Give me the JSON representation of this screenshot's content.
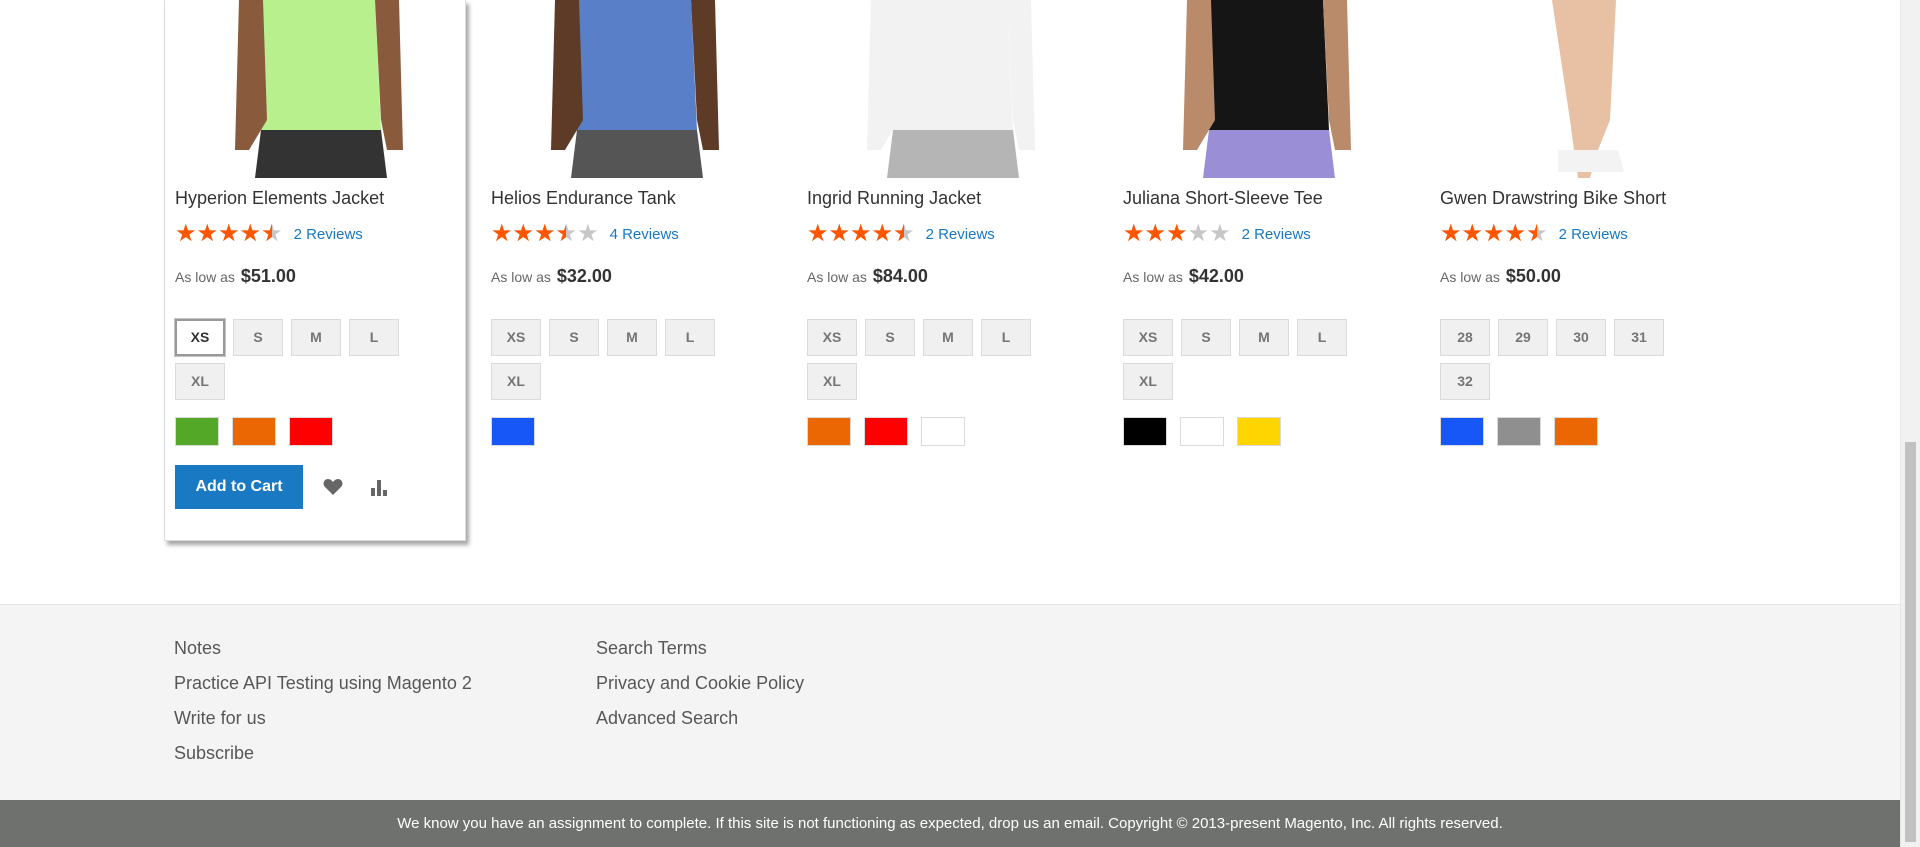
{
  "products": [
    {
      "name": "Hyperion Elements Jacket",
      "rating_percent": 90,
      "reviews": "2 Reviews",
      "price_prefix": "As low as",
      "price": "$51.00",
      "sizes": [
        "XS",
        "S",
        "M",
        "L",
        "XL"
      ],
      "selected_size": "XS",
      "colors": [
        "#53a828",
        "#eb6703",
        "#ff0000"
      ],
      "hovered": true,
      "add_to_cart": "Add to Cart",
      "wishlist_icon": "heart-icon",
      "compare_icon": "bar-chart-icon",
      "image": {
        "top": "#b8f08e",
        "bottom": "#333333",
        "skin": "#8a5a3c"
      }
    },
    {
      "name": "Helios Endurance Tank",
      "rating_percent": 70,
      "reviews": "4 Reviews",
      "price_prefix": "As low as",
      "price": "$32.00",
      "sizes": [
        "XS",
        "S",
        "M",
        "L",
        "XL"
      ],
      "selected_size": null,
      "colors": [
        "#1857f7"
      ],
      "hovered": false,
      "image": {
        "top": "#5a7fc9",
        "bottom": "#555555",
        "skin": "#5e3b27"
      }
    },
    {
      "name": "Ingrid Running Jacket",
      "rating_percent": 90,
      "reviews": "2 Reviews",
      "price_prefix": "As low as",
      "price": "$84.00",
      "sizes": [
        "XS",
        "S",
        "M",
        "L",
        "XL"
      ],
      "selected_size": null,
      "colors": [
        "#eb6703",
        "#ff0000",
        "#ffffff"
      ],
      "hovered": false,
      "image": {
        "top": "#f2f2f2",
        "bottom": "#b5b5b5",
        "skin": "#e8c7b0"
      }
    },
    {
      "name": "Juliana Short-Sleeve Tee",
      "rating_percent": 60,
      "reviews": "2 Reviews",
      "price_prefix": "As low as",
      "price": "$42.00",
      "sizes": [
        "XS",
        "S",
        "M",
        "L",
        "XL"
      ],
      "selected_size": null,
      "colors": [
        "#000000",
        "#ffffff",
        "#ffd500"
      ],
      "hovered": false,
      "image": {
        "top": "#151515",
        "bottom": "#9a8fd6",
        "skin": "#b98b6a"
      }
    },
    {
      "name": "Gwen Drawstring Bike Short",
      "rating_percent": 90,
      "reviews": "2 Reviews",
      "price_prefix": "As low as",
      "price": "$50.00",
      "sizes": [
        "28",
        "29",
        "30",
        "31",
        "32"
      ],
      "selected_size": null,
      "colors": [
        "#1857f7",
        "#8f8f8f",
        "#eb6703"
      ],
      "hovered": false,
      "image": {
        "top": "#e8c0a3",
        "bottom": "#f3f3f3",
        "skin": "#e8c0a3"
      }
    }
  ],
  "footer": {
    "col1": [
      "Notes",
      "Practice API Testing using Magento 2",
      "Write for us",
      "Subscribe"
    ],
    "col2": [
      "Search Terms",
      "Privacy and Cookie Policy",
      "Advanced Search"
    ],
    "copyright": "We know you have an assignment to complete. If this site is not functioning as expected, drop us an email. Copyright © 2013-present Magento, Inc. All rights reserved."
  }
}
